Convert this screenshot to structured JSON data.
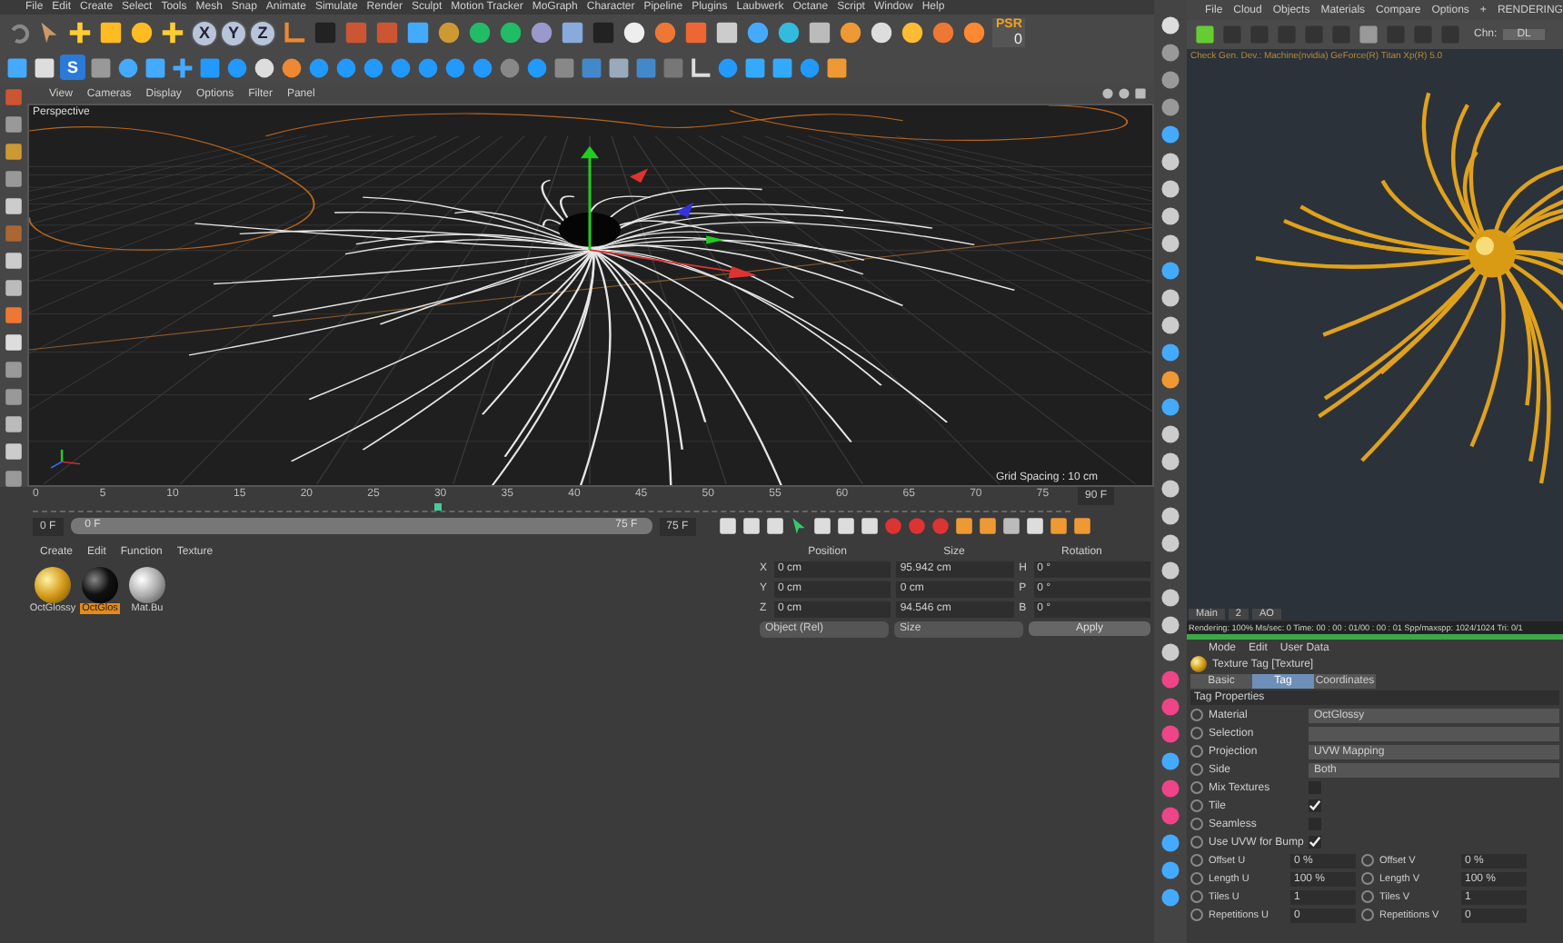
{
  "menu_bar": [
    "File",
    "Edit",
    "Create",
    "Select",
    "Tools",
    "Mesh",
    "Snap",
    "Animate",
    "Simulate",
    "Render",
    "Sculpt",
    "Motion Tracker",
    "MoGraph",
    "Character",
    "Pipeline",
    "Plugins",
    "Laubwerk",
    "Octane",
    "Script",
    "Window",
    "Help"
  ],
  "toolbar": {
    "axis_buttons": [
      "X",
      "Y",
      "Z"
    ],
    "psr": {
      "label": "PSR",
      "value": "0"
    },
    "s_button": "S"
  },
  "viewport": {
    "menu": [
      "View",
      "Cameras",
      "Display",
      "Options",
      "Filter",
      "Panel"
    ],
    "camera_label": "Perspective",
    "grid_spacing": "Grid Spacing : 10 cm"
  },
  "timeline": {
    "ticks": [
      "0",
      "5",
      "10",
      "15",
      "20",
      "25",
      "30",
      "35",
      "40",
      "45",
      "50",
      "55",
      "60",
      "65",
      "70",
      "75"
    ],
    "end_field": "90 F",
    "start_field": "0 F",
    "range_start": "0 F",
    "range_end": "75 F",
    "range": {
      "level": 1
    },
    "max_field": "75 F"
  },
  "material_manager": {
    "menu": [
      "Create",
      "Edit",
      "Function",
      "Texture"
    ],
    "materials": [
      {
        "name": "OctGlossy",
        "kind": "gold",
        "selected": false
      },
      {
        "name": "OctGlos",
        "kind": "black",
        "selected": true
      },
      {
        "name": "Mat.Bu",
        "kind": "white",
        "selected": false
      }
    ]
  },
  "coordinates": {
    "headers": [
      "Position",
      "Size",
      "Rotation"
    ],
    "rows": [
      {
        "axis": "X",
        "position": "0 cm",
        "size": "95.942 cm",
        "rot_axis": "H",
        "rotation": "0 °"
      },
      {
        "axis": "Y",
        "position": "0 cm",
        "size": "0 cm",
        "rot_axis": "P",
        "rotation": "0 °"
      },
      {
        "axis": "Z",
        "position": "0 cm",
        "size": "94.546 cm",
        "rot_axis": "B",
        "rotation": "0 °"
      }
    ],
    "mode_dropdown": "Object (Rel)",
    "size_dropdown": "Size",
    "apply_button": "Apply"
  },
  "octane": {
    "menu": [
      "File",
      "Cloud",
      "Objects",
      "Materials",
      "Compare",
      "Options",
      "+",
      "RENDERING"
    ],
    "channel_label": "Chn:",
    "channel_value": "DL",
    "info": "Check Gen. Dev.: Machine(nvidia) GeForce(R) Titan Xp(R) 5.0",
    "render_tabs": [
      "Main",
      "2",
      "AO"
    ],
    "status": "Rendering: 100%  Ms/sec: 0  Time: 00 : 00 : 01/00 : 00 : 01  Spp/maxspp: 1024/1024  Tri: 0/1",
    "progress": {
      "level": 1
    }
  },
  "attributes": {
    "menu": [
      "Mode",
      "Edit",
      "User Data"
    ],
    "title": "Texture Tag [Texture]",
    "tabs": [
      {
        "label": "Basic",
        "selected": false
      },
      {
        "label": "Tag",
        "selected": true
      },
      {
        "label": "Coordinates",
        "selected": false
      }
    ],
    "section": "Tag Properties",
    "fields": [
      {
        "label": "Material",
        "value": "OctGlossy"
      },
      {
        "label": "Selection"
      },
      {
        "label": "Projection",
        "value": "UVW Mapping"
      },
      {
        "label": "Side",
        "value": "Both"
      }
    ],
    "checks": [
      {
        "label": "Mix Textures",
        "checked": false
      },
      {
        "label": "Tile",
        "checked": true
      },
      {
        "label": "Seamless",
        "checked": false
      },
      {
        "label": "Use UVW for Bump",
        "checked": true
      }
    ],
    "pairs": [
      {
        "left_label": "Offset U",
        "left_value": "0 %",
        "right_label": "Offset V",
        "right_value": "0 %"
      },
      {
        "left_label": "Length U",
        "left_value": "100 %",
        "right_label": "Length V",
        "right_value": "100 %"
      },
      {
        "left_label": "Tiles U",
        "left_value": "1",
        "right_label": "Tiles V",
        "right_value": "1"
      },
      {
        "left_label": "Repetitions U",
        "left_value": "0",
        "right_label": "Repetitions V",
        "right_value": "0"
      }
    ]
  }
}
